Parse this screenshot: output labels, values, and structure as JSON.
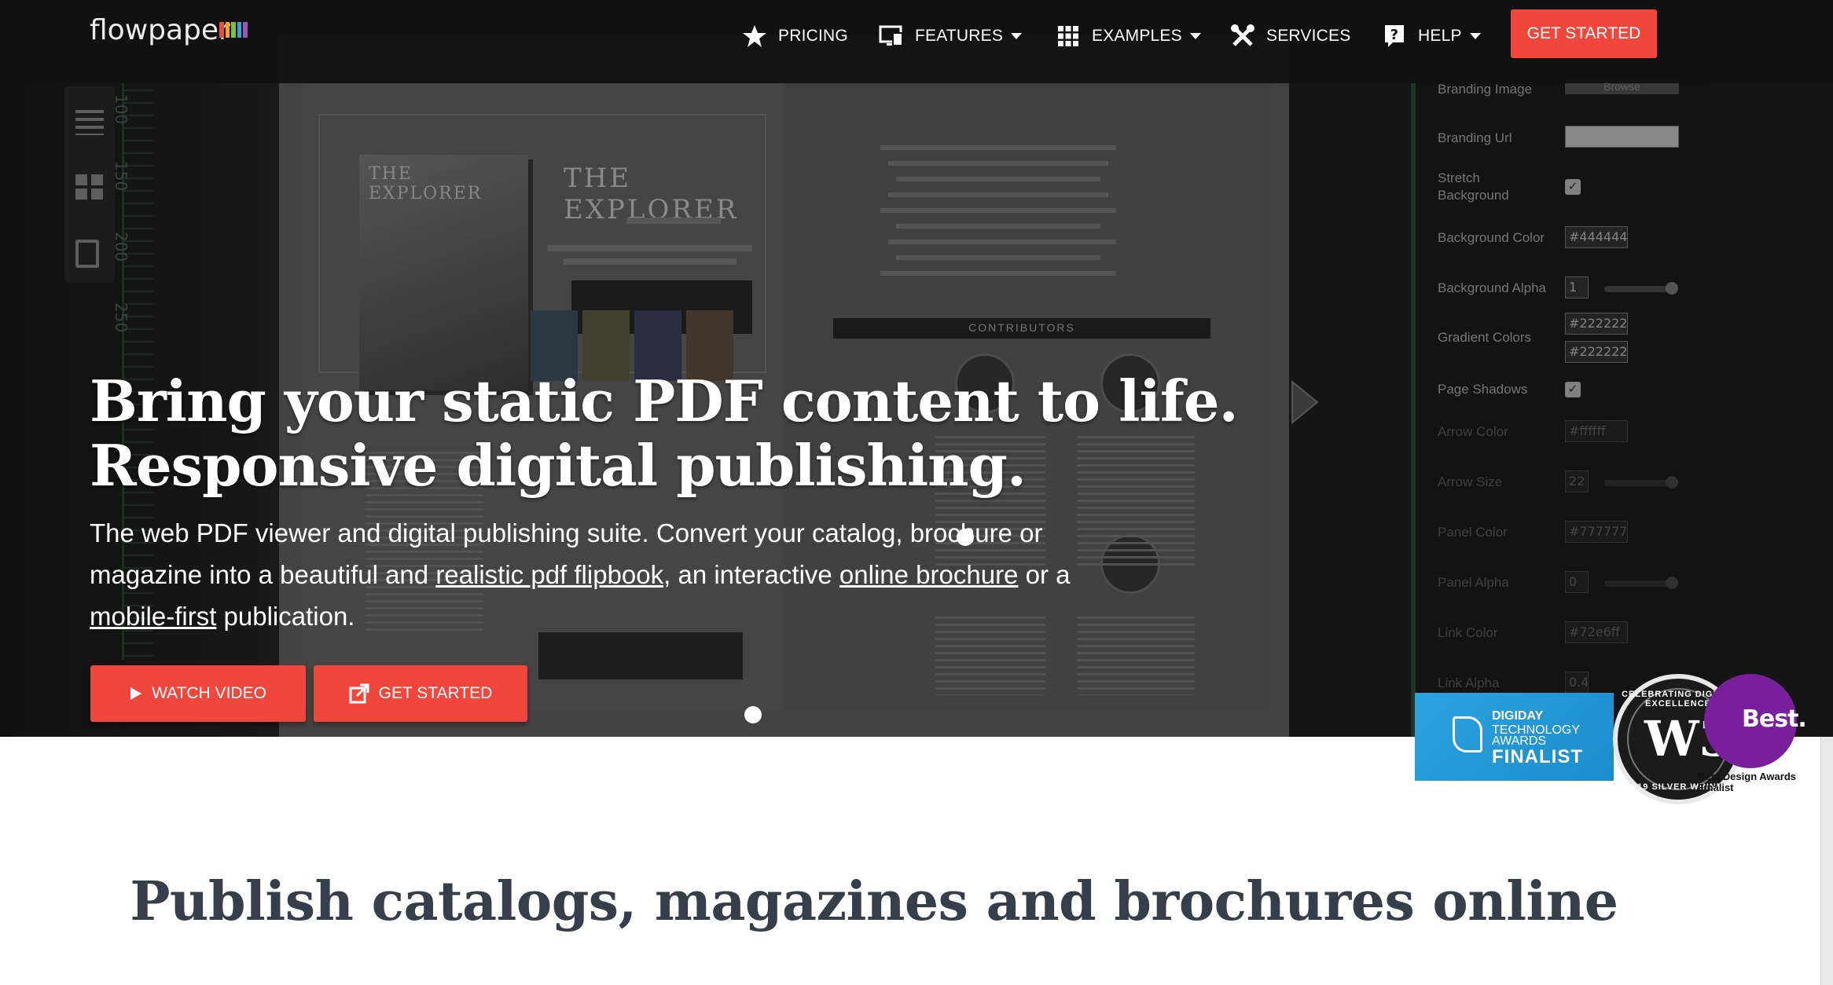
{
  "nav": {
    "logo": "flowpaper",
    "logo_colors": [
      "#e94b3c",
      "#f4a623",
      "#7ac142",
      "#3aa0d8",
      "#9b59b6"
    ],
    "items": [
      {
        "label": "PRICING",
        "icon": "star-icon",
        "dropdown": false
      },
      {
        "label": "FEATURES",
        "icon": "monitor-icon",
        "dropdown": true
      },
      {
        "label": "EXAMPLES",
        "icon": "grid-icon",
        "dropdown": true
      },
      {
        "label": "SERVICES",
        "icon": "tools-icon",
        "dropdown": false
      },
      {
        "label": "HELP",
        "icon": "question-icon",
        "dropdown": true
      }
    ],
    "cta": "GET STARTED",
    "accent": "#f0463c"
  },
  "hero": {
    "headline_1": "Bring your static PDF content to life.",
    "headline_2": "Responsive digital publishing.",
    "text_1": "The web PDF viewer and digital publishing suite. Convert your catalog, brochure or magazine into a beautiful and ",
    "link_1": "realistic pdf flipbook",
    "text_2": ", an interactive ",
    "link_2": "online brochure",
    "text_3": " or a ",
    "link_3": "mobile-first",
    "text_4": " publication.",
    "watch_video": "WATCH VIDEO",
    "get_started": "GET STARTED"
  },
  "mock": {
    "ruler_marks": [
      "100",
      "150",
      "200",
      "250"
    ],
    "magazine_title": "THE EXPLORER",
    "book_title": "THE EXPLORER",
    "contributors": "CONTRIBUTORS"
  },
  "settings": {
    "branding_image": "Branding Image",
    "browse": "Browse",
    "branding_url": "Branding Url",
    "stretch_bg": "Stretch Background",
    "bg_color_label": "Background Color",
    "bg_color": "#444444",
    "bg_alpha_label": "Background Alpha",
    "bg_alpha": "1",
    "gradient_label": "Gradient Colors",
    "gradient_1": "#222222",
    "gradient_2": "#222222",
    "page_shadows": "Page Shadows",
    "arrow_color_label": "Arrow Color",
    "arrow_color": "#ffffff",
    "arrow_size_label": "Arrow Size",
    "arrow_size": "22",
    "panel_color_label": "Panel Color",
    "panel_color": "#777777",
    "panel_alpha_label": "Panel Alpha",
    "panel_alpha": "0",
    "link_color_label": "Link Color",
    "link_color": "#72e6ff",
    "link_alpha_label": "Link Alpha",
    "link_alpha": "0.4"
  },
  "badges": {
    "digiday_1": "DIGIDAY",
    "digiday_2": "TECHNOLOGY",
    "digiday_3": "AWARDS",
    "digiday_4": "FINALIST",
    "w3_top": "CELEBRATING DIGITAL EXCELLENCE",
    "w3_mark": "W3",
    "w3_bottom": "2019 SILVER WINNER",
    "best": "Best.",
    "best_sub_1": "Best Design Awards",
    "best_sub_2": "Finalist"
  },
  "section": {
    "title": "Publish catalogs, magazines and brochures online"
  }
}
